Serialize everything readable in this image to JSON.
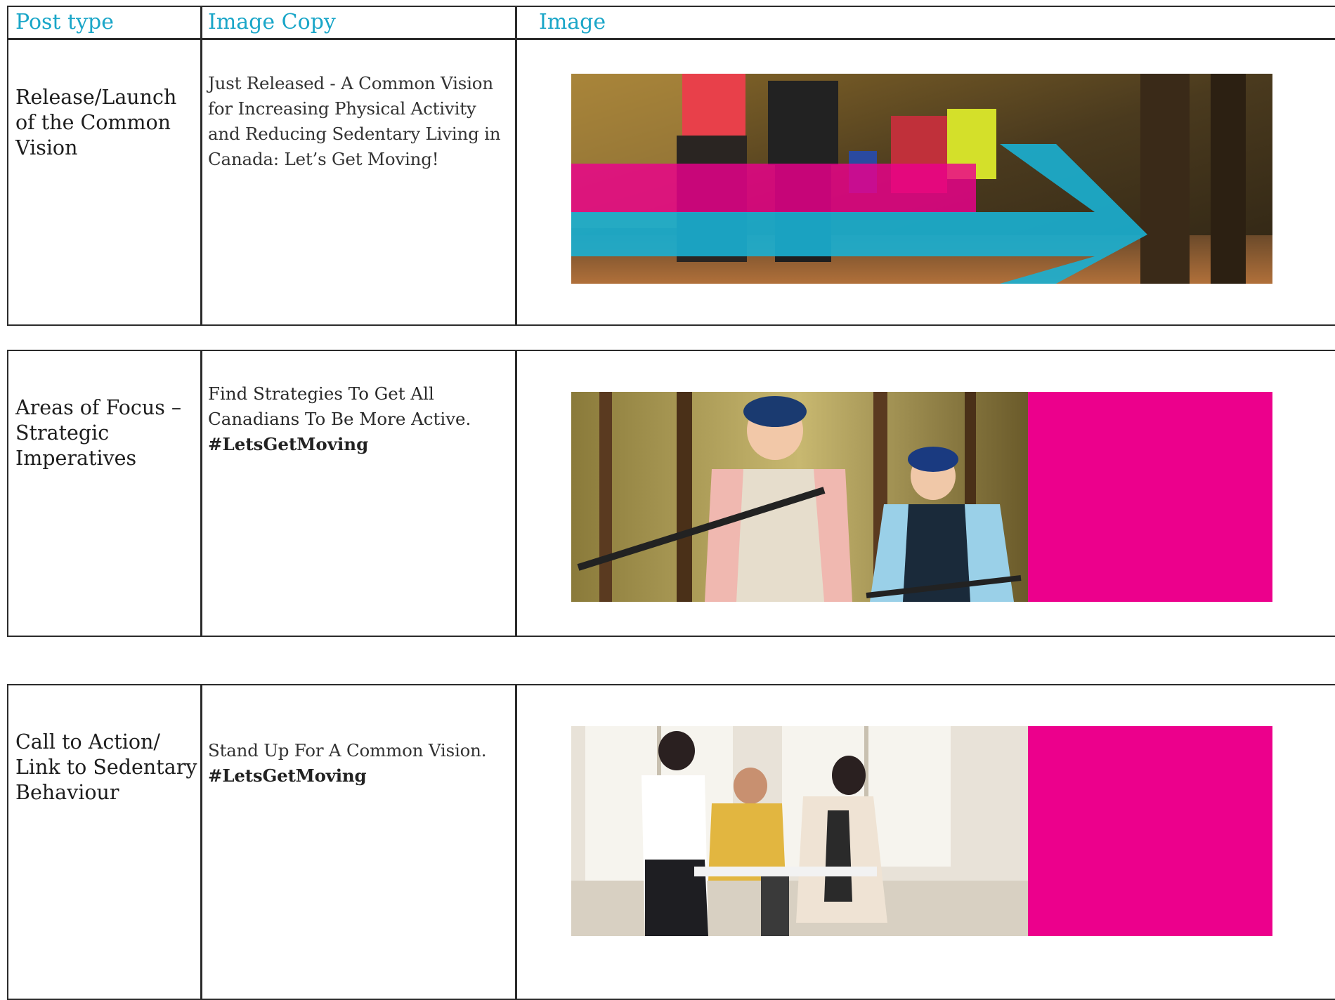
{
  "header": {
    "post_type": "Post type",
    "image_copy": "Image Copy",
    "image": "Image"
  },
  "rows": [
    {
      "post_type": "Release/Launch of the Common Vision",
      "copy_lines": [
        "Just Released - A Common Vision",
        "for Increasing Physical Activity",
        "and Reducing Sedentary Living in",
        "Canada: Let’s Get Moving!"
      ],
      "hashtag": ""
    },
    {
      "post_type": "Areas of Focus – Strategic Imperatives",
      "copy_lines": [
        "Find Strategies To Get All",
        "Canadians To Be More Active."
      ],
      "hashtag": "#LetsGetMoving"
    },
    {
      "post_type": "Call to Action/ Link to Sedentary Behaviour",
      "copy_lines": [
        "Stand Up For A Common Vision."
      ],
      "hashtag": "#LetsGetMoving"
    }
  ],
  "colors": {
    "header_text": "#1aa6c8",
    "magenta": "#ec008c",
    "cyan": "#1ab0d3",
    "border": "#2b2b2b"
  }
}
